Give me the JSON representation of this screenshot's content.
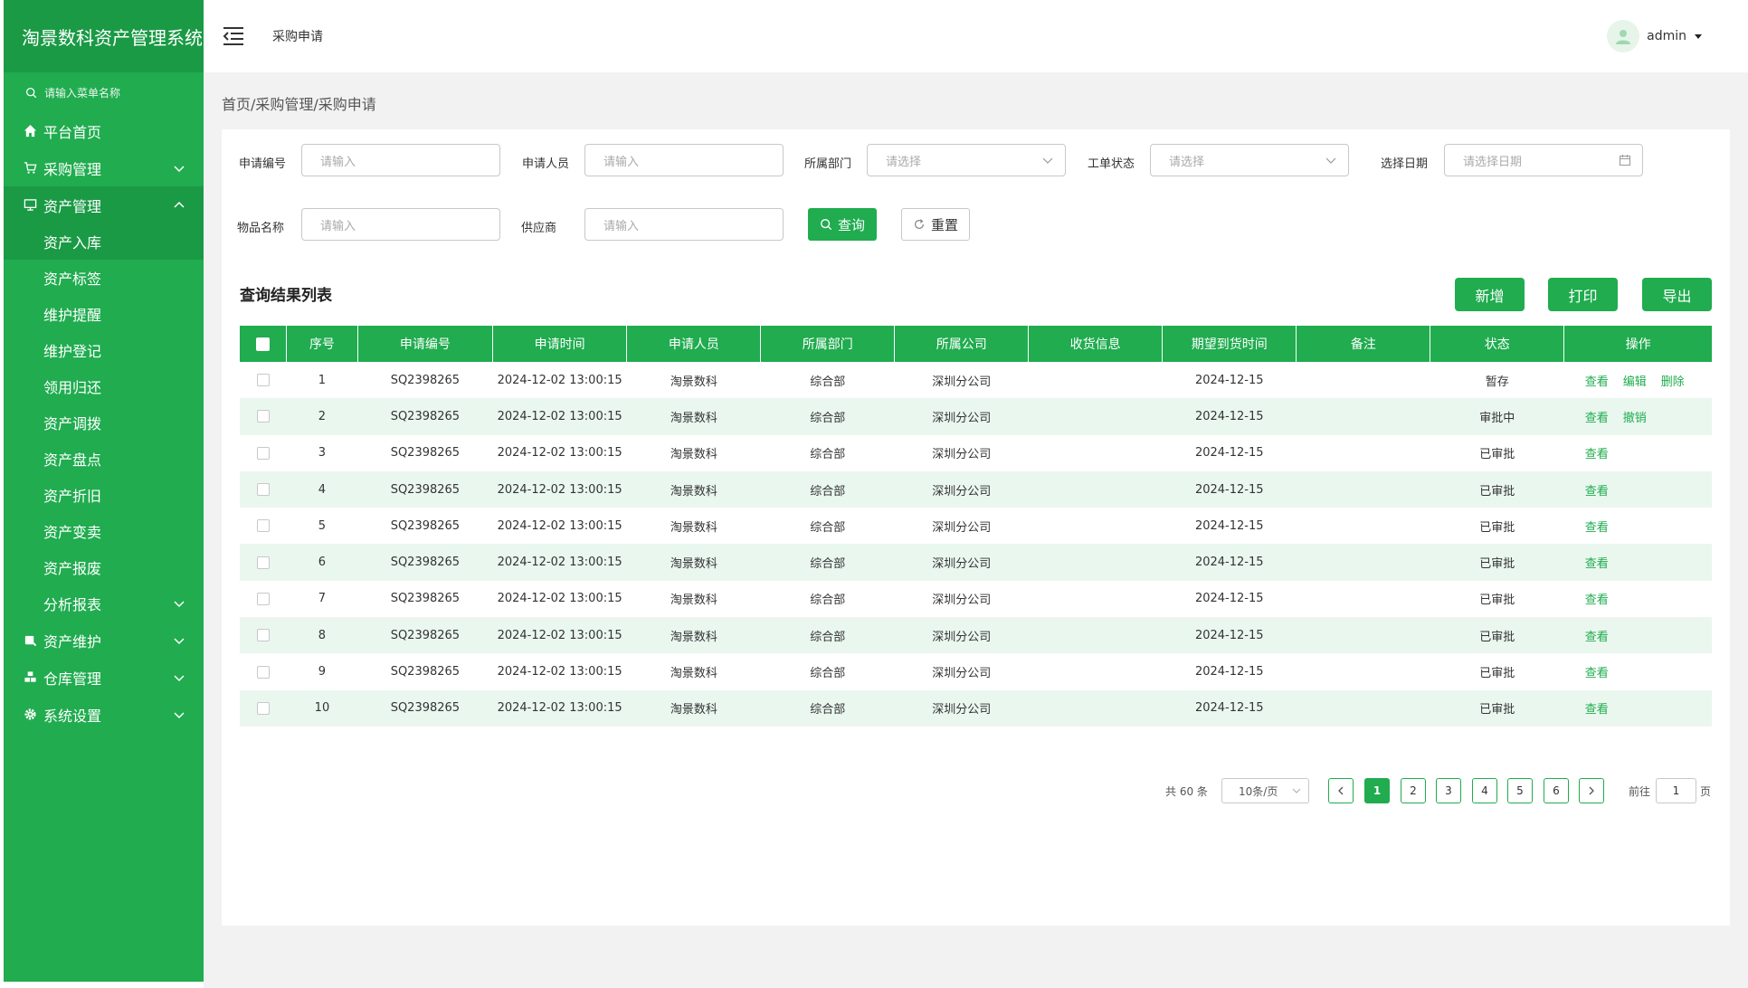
{
  "app": {
    "title": "淘景数科资产管理系统"
  },
  "sidebar": {
    "search_placeholder": "请输入菜单名称",
    "menu": {
      "home": "平台首页",
      "purchase": "采购管理",
      "asset": "资产管理",
      "asset_maintain": "资产维护",
      "warehouse": "仓库管理",
      "settings": "系统设置"
    },
    "submenu": [
      "资产入库",
      "资产标签",
      "维护提醒",
      "维护登记",
      "领用归还",
      "资产调拨",
      "资产盘点",
      "资产折旧",
      "资产变卖",
      "资产报废",
      "分析报表"
    ]
  },
  "header": {
    "title": "采购申请",
    "user": "admin"
  },
  "breadcrumb": "首页/采购管理/采购申请",
  "filters": {
    "apply_no": {
      "label": "申请编号",
      "placeholder": "请输入"
    },
    "applicant": {
      "label": "申请人员",
      "placeholder": "请输入"
    },
    "dept": {
      "label": "所属部门",
      "placeholder": "请选择"
    },
    "status": {
      "label": "工单状态",
      "placeholder": "请选择"
    },
    "date": {
      "label": "选择日期",
      "placeholder": "请选择日期"
    },
    "item": {
      "label": "物品名称",
      "placeholder": "请输入"
    },
    "supplier": {
      "label": "供应商",
      "placeholder": "请输入"
    },
    "query_label": "查询",
    "reset_label": "重置"
  },
  "results": {
    "title": "查询结果列表",
    "add_label": "新增",
    "print_label": "打印",
    "export_label": "导出"
  },
  "table": {
    "headers": [
      "序号",
      "申请编号",
      "申请时间",
      "申请人员",
      "所属部门",
      "所属公司",
      "收货信息",
      "期望到货时间",
      "备注",
      "状态",
      "操作"
    ],
    "rows": [
      {
        "no": "1",
        "code": "SQ2398265",
        "time": "2024-12-02 13:00:15",
        "applicant": "淘景数科",
        "dept": "综合部",
        "company": "深圳分公司",
        "receive": "",
        "expect": "2024-12-15",
        "remark": "",
        "status": "暂存",
        "ops": [
          "查看",
          "编辑",
          "删除"
        ]
      },
      {
        "no": "2",
        "code": "SQ2398265",
        "time": "2024-12-02 13:00:15",
        "applicant": "淘景数科",
        "dept": "综合部",
        "company": "深圳分公司",
        "receive": "",
        "expect": "2024-12-15",
        "remark": "",
        "status": "审批中",
        "ops": [
          "查看",
          "撤销"
        ]
      },
      {
        "no": "3",
        "code": "SQ2398265",
        "time": "2024-12-02 13:00:15",
        "applicant": "淘景数科",
        "dept": "综合部",
        "company": "深圳分公司",
        "receive": "",
        "expect": "2024-12-15",
        "remark": "",
        "status": "已审批",
        "ops": [
          "查看"
        ]
      },
      {
        "no": "4",
        "code": "SQ2398265",
        "time": "2024-12-02 13:00:15",
        "applicant": "淘景数科",
        "dept": "综合部",
        "company": "深圳分公司",
        "receive": "",
        "expect": "2024-12-15",
        "remark": "",
        "status": "已审批",
        "ops": [
          "查看"
        ]
      },
      {
        "no": "5",
        "code": "SQ2398265",
        "time": "2024-12-02 13:00:15",
        "applicant": "淘景数科",
        "dept": "综合部",
        "company": "深圳分公司",
        "receive": "",
        "expect": "2024-12-15",
        "remark": "",
        "status": "已审批",
        "ops": [
          "查看"
        ]
      },
      {
        "no": "6",
        "code": "SQ2398265",
        "time": "2024-12-02 13:00:15",
        "applicant": "淘景数科",
        "dept": "综合部",
        "company": "深圳分公司",
        "receive": "",
        "expect": "2024-12-15",
        "remark": "",
        "status": "已审批",
        "ops": [
          "查看"
        ]
      },
      {
        "no": "7",
        "code": "SQ2398265",
        "time": "2024-12-02 13:00:15",
        "applicant": "淘景数科",
        "dept": "综合部",
        "company": "深圳分公司",
        "receive": "",
        "expect": "2024-12-15",
        "remark": "",
        "status": "已审批",
        "ops": [
          "查看"
        ]
      },
      {
        "no": "8",
        "code": "SQ2398265",
        "time": "2024-12-02 13:00:15",
        "applicant": "淘景数科",
        "dept": "综合部",
        "company": "深圳分公司",
        "receive": "",
        "expect": "2024-12-15",
        "remark": "",
        "status": "已审批",
        "ops": [
          "查看"
        ]
      },
      {
        "no": "9",
        "code": "SQ2398265",
        "time": "2024-12-02 13:00:15",
        "applicant": "淘景数科",
        "dept": "综合部",
        "company": "深圳分公司",
        "receive": "",
        "expect": "2024-12-15",
        "remark": "",
        "status": "已审批",
        "ops": [
          "查看"
        ]
      },
      {
        "no": "10",
        "code": "SQ2398265",
        "time": "2024-12-02 13:00:15",
        "applicant": "淘景数科",
        "dept": "综合部",
        "company": "深圳分公司",
        "receive": "",
        "expect": "2024-12-15",
        "remark": "",
        "status": "已审批",
        "ops": [
          "查看"
        ]
      }
    ]
  },
  "pagination": {
    "total_text": "共 60 条",
    "page_size": "10条/页",
    "pages": [
      "1",
      "2",
      "3",
      "4",
      "5",
      "6"
    ],
    "current": "1",
    "goto_prefix": "前往",
    "goto_value": "1",
    "goto_suffix": "页"
  },
  "colors": {
    "brand": "#20ac4f",
    "brand_dark": "#1a9a45",
    "row_alt": "#eaf7ef"
  }
}
